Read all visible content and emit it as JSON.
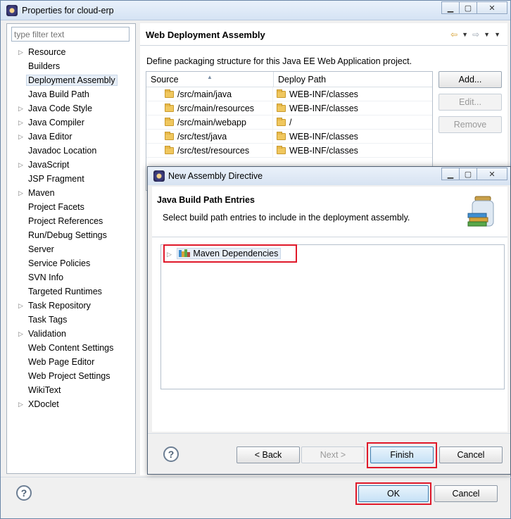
{
  "window": {
    "title": "Properties for cloud-erp",
    "minimize": "▁",
    "maximize": "▢",
    "close": "✕"
  },
  "left_pane": {
    "filter_placeholder": "type filter text",
    "items": [
      {
        "label": "Resource",
        "expandable": true
      },
      {
        "label": "Builders",
        "expandable": false
      },
      {
        "label": "Deployment Assembly",
        "expandable": false,
        "selected": true
      },
      {
        "label": "Java Build Path",
        "expandable": false
      },
      {
        "label": "Java Code Style",
        "expandable": true
      },
      {
        "label": "Java Compiler",
        "expandable": true
      },
      {
        "label": "Java Editor",
        "expandable": true
      },
      {
        "label": "Javadoc Location",
        "expandable": false
      },
      {
        "label": "JavaScript",
        "expandable": true
      },
      {
        "label": "JSP Fragment",
        "expandable": false
      },
      {
        "label": "Maven",
        "expandable": true
      },
      {
        "label": "Project Facets",
        "expandable": false
      },
      {
        "label": "Project References",
        "expandable": false
      },
      {
        "label": "Run/Debug Settings",
        "expandable": false
      },
      {
        "label": "Server",
        "expandable": false
      },
      {
        "label": "Service Policies",
        "expandable": false
      },
      {
        "label": "SVN Info",
        "expandable": false
      },
      {
        "label": "Targeted Runtimes",
        "expandable": false
      },
      {
        "label": "Task Repository",
        "expandable": true
      },
      {
        "label": "Task Tags",
        "expandable": false
      },
      {
        "label": "Validation",
        "expandable": true
      },
      {
        "label": "Web Content Settings",
        "expandable": false
      },
      {
        "label": "Web Page Editor",
        "expandable": false
      },
      {
        "label": "Web Project Settings",
        "expandable": false
      },
      {
        "label": "WikiText",
        "expandable": false
      },
      {
        "label": "XDoclet",
        "expandable": true
      }
    ]
  },
  "page": {
    "title": "Web Deployment Assembly",
    "description": "Define packaging structure for this Java EE Web Application project.",
    "columns": {
      "source": "Source",
      "deploy_path": "Deploy Path"
    },
    "rows": [
      {
        "source": "/src/main/java",
        "deploy": "WEB-INF/classes"
      },
      {
        "source": "/src/main/resources",
        "deploy": "WEB-INF/classes"
      },
      {
        "source": "/src/main/webapp",
        "deploy": "/"
      },
      {
        "source": "/src/test/java",
        "deploy": "WEB-INF/classes"
      },
      {
        "source": "/src/test/resources",
        "deploy": "WEB-INF/classes"
      }
    ],
    "buttons": {
      "add": "Add...",
      "edit": "Edit...",
      "remove": "Remove"
    }
  },
  "footer": {
    "help": "?",
    "ok": "OK",
    "cancel": "Cancel"
  },
  "dialog": {
    "title": "New Assembly Directive",
    "header_title": "Java Build Path Entries",
    "header_desc": "Select build path entries to include in the deployment assembly.",
    "tree_item": "Maven Dependencies",
    "help": "?",
    "back": "< Back",
    "next": "Next >",
    "finish": "Finish",
    "cancel": "Cancel"
  },
  "colors": {
    "highlight_box": "#e0192a",
    "selection": "#e7eef7",
    "accent": "#3c7fb1"
  }
}
